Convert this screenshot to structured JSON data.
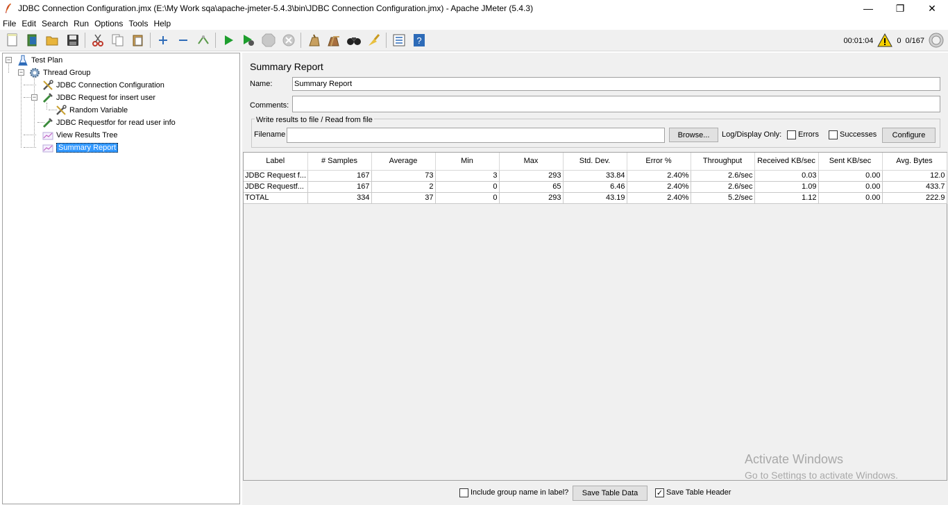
{
  "window": {
    "title": "JDBC Connection Configuration.jmx (E:\\My Work sqa\\apache-jmeter-5.4.3\\bin\\JDBC Connection Configuration.jmx) - Apache JMeter (5.4.3)",
    "minimize": "—",
    "restore": "❐",
    "close": "✕"
  },
  "menu": [
    "File",
    "Edit",
    "Search",
    "Run",
    "Options",
    "Tools",
    "Help"
  ],
  "toolbar_status": {
    "elapsed": "00:01:04",
    "warnings": "0",
    "threads": "0/167"
  },
  "tree": {
    "items": [
      {
        "label": "Test Plan"
      },
      {
        "label": "Thread Group"
      },
      {
        "label": "JDBC Connection Configuration"
      },
      {
        "label": "JDBC Request for insert user"
      },
      {
        "label": "Random Variable"
      },
      {
        "label": "JDBC Requestfor for read user info"
      },
      {
        "label": "View Results Tree"
      },
      {
        "label": "Summary Report"
      }
    ],
    "selected": "Summary Report"
  },
  "report": {
    "title": "Summary Report",
    "name_label": "Name:",
    "name_value": "Summary Report",
    "comments_label": "Comments:",
    "comments_value": "",
    "group_title": "Write results to file / Read from file",
    "filename_label": "Filename",
    "filename_value": "",
    "browse_button": "Browse...",
    "log_display_label": "Log/Display Only:",
    "errors_label": "Errors",
    "successes_label": "Successes",
    "configure_button": "Configure"
  },
  "table": {
    "columns": [
      "Label",
      "# Samples",
      "Average",
      "Min",
      "Max",
      "Std. Dev.",
      "Error %",
      "Throughput",
      "Received KB/sec",
      "Sent KB/sec",
      "Avg. Bytes"
    ],
    "rows": [
      [
        "JDBC Request f...",
        "167",
        "73",
        "3",
        "293",
        "33.84",
        "2.40%",
        "2.6/sec",
        "0.03",
        "0.00",
        "12.0"
      ],
      [
        "JDBC Requestf...",
        "167",
        "2",
        "0",
        "65",
        "6.46",
        "2.40%",
        "2.6/sec",
        "1.09",
        "0.00",
        "433.7"
      ],
      [
        "TOTAL",
        "334",
        "37",
        "0",
        "293",
        "43.19",
        "2.40%",
        "5.2/sec",
        "1.12",
        "0.00",
        "222.9"
      ]
    ]
  },
  "bottom": {
    "include_group_label": "Include group name in label?",
    "include_group_checked": false,
    "save_table_data": "Save Table Data",
    "save_table_header": "Save Table Header",
    "save_table_header_checked": true
  },
  "watermark": {
    "line1": "Activate Windows",
    "line2": "Go to Settings to activate Windows."
  }
}
